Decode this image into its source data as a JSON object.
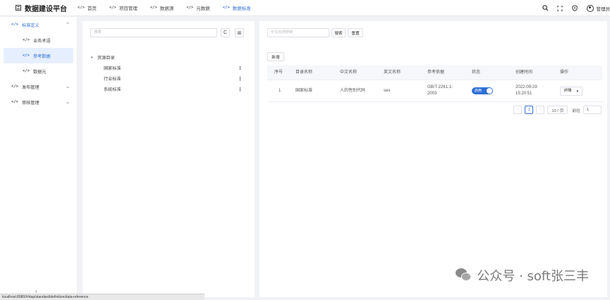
{
  "app": {
    "title": "数据建设平台"
  },
  "topnav": {
    "items": [
      {
        "label": "首页"
      },
      {
        "label": "项目管理"
      },
      {
        "label": "数据源"
      },
      {
        "label": "元数据"
      },
      {
        "label": "数据标准"
      }
    ],
    "active_index": 4,
    "code_glyph": "</>"
  },
  "topbar_right": {
    "icons": [
      "search-icon",
      "fullscreen-icon",
      "shield-icon"
    ],
    "user_label": "管理员"
  },
  "sidebar": {
    "groups": [
      {
        "label": "标准定义",
        "expanded": true
      },
      {
        "label": "发布管理",
        "expanded": false
      },
      {
        "label": "审核管理",
        "expanded": false
      }
    ],
    "children": [
      {
        "label": "业务术语"
      },
      {
        "label": "参考数据"
      },
      {
        "label": "数据元"
      }
    ],
    "selected_child": 1,
    "collapse_glyph": "‹"
  },
  "left_panel": {
    "search_placeholder": "搜索",
    "refresh_glyph": "C",
    "expand_glyph": "⊞",
    "tree": {
      "root": "资源目录",
      "children": [
        "国家标准",
        "行业标准",
        "系统标准"
      ],
      "more_glyph": "⋮"
    }
  },
  "right_panel": {
    "query_placeholder": "中文名称搜索",
    "search_button": "搜索",
    "reset_button": "重置",
    "new_button": "新增",
    "table": {
      "columns": [
        "序号",
        "目录名称",
        "中文名称",
        "英文名称",
        "参考依据",
        "状态",
        "创建时间",
        "操作"
      ],
      "rows": [
        {
          "index": "1",
          "catalog": "国家标准",
          "cn_name": "人的性别代码",
          "en_name": "sex",
          "basis_line1": "GB/T 2261.1-",
          "basis_line2": "2003",
          "status": "启用",
          "status_on": true,
          "created_date": "2022-09-29",
          "created_time": "15:20:51",
          "action": "详情"
        }
      ]
    },
    "pagination": {
      "prev": "‹",
      "current": "1",
      "next": "›",
      "page_size": "10 / 页",
      "jump_label": "前往",
      "jump_value": "1"
    }
  },
  "statusbar": {
    "url": "localhost:8080/#/dap/standard/definition/data-reference"
  },
  "watermark": {
    "text": "公众号 · soft张三丰"
  },
  "colors": {
    "accent": "#2f6fd6",
    "selected_bg": "#e6efff",
    "page_bg": "#f0f2f5"
  }
}
